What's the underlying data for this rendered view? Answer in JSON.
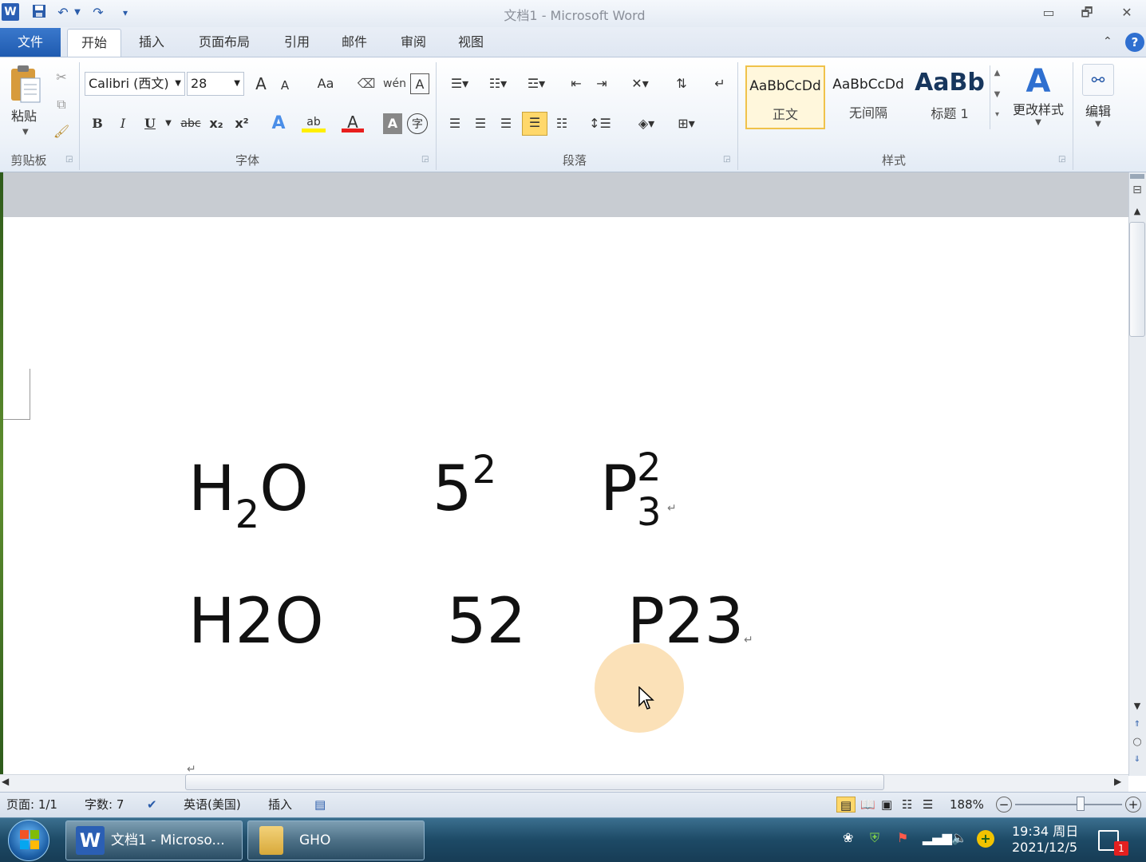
{
  "window": {
    "title": "文档1 - Microsoft Word",
    "min": "▭",
    "restore": "🗗",
    "close": "✕"
  },
  "tabs": {
    "file": "文件",
    "home": "开始",
    "insert": "插入",
    "layout": "页面布局",
    "references": "引用",
    "mail": "邮件",
    "review": "审阅",
    "view": "视图"
  },
  "clipboard": {
    "paste": "粘贴",
    "label": "剪贴板"
  },
  "font": {
    "name": "Calibri (西文)",
    "size": "28",
    "label": "字体",
    "bold": "B",
    "italic": "I",
    "underline": "U",
    "strike": "abc",
    "subscript": "x₂",
    "superscript": "x²",
    "grow": "A",
    "shrink": "A",
    "case": "Aa",
    "color_a": "A",
    "charshade": "A",
    "enclose": "字",
    "highlight": "ab"
  },
  "paragraph": {
    "label": "段落"
  },
  "styles": {
    "label": "样式",
    "items": [
      {
        "preview": "AaBbCcDd",
        "name": "正文"
      },
      {
        "preview": "AaBbCcDd",
        "name": "无间隔"
      },
      {
        "preview": "AaBb",
        "name": "标题 1"
      }
    ],
    "change": "更改样式"
  },
  "editing": {
    "label": "编辑"
  },
  "document": {
    "line1": {
      "a_main": "H",
      "a_sub": "2",
      "a_end": "O",
      "b_main": "5",
      "b_sup": "2",
      "c_main": "P",
      "c_sup": "2",
      "c_sub": "3"
    },
    "line2": {
      "a": "H2O",
      "b": "52",
      "c": "P23"
    },
    "para_mark": "↵"
  },
  "statusbar": {
    "page": "页面: 1/1",
    "words": "字数: 7",
    "language": "英语(美国)",
    "mode": "插入",
    "zoom": "188%",
    "zoom_percent": 188
  },
  "taskbar": {
    "word_task": "文档1 - Microso...",
    "folder_task": "GHO",
    "time": "19:34 周日",
    "date": "2021/12/5",
    "notify_count": "1"
  },
  "colors": {
    "accent": "#2b5fb4",
    "file_tab": "#1f5bb0",
    "highlight_style": "#ffd86b"
  }
}
